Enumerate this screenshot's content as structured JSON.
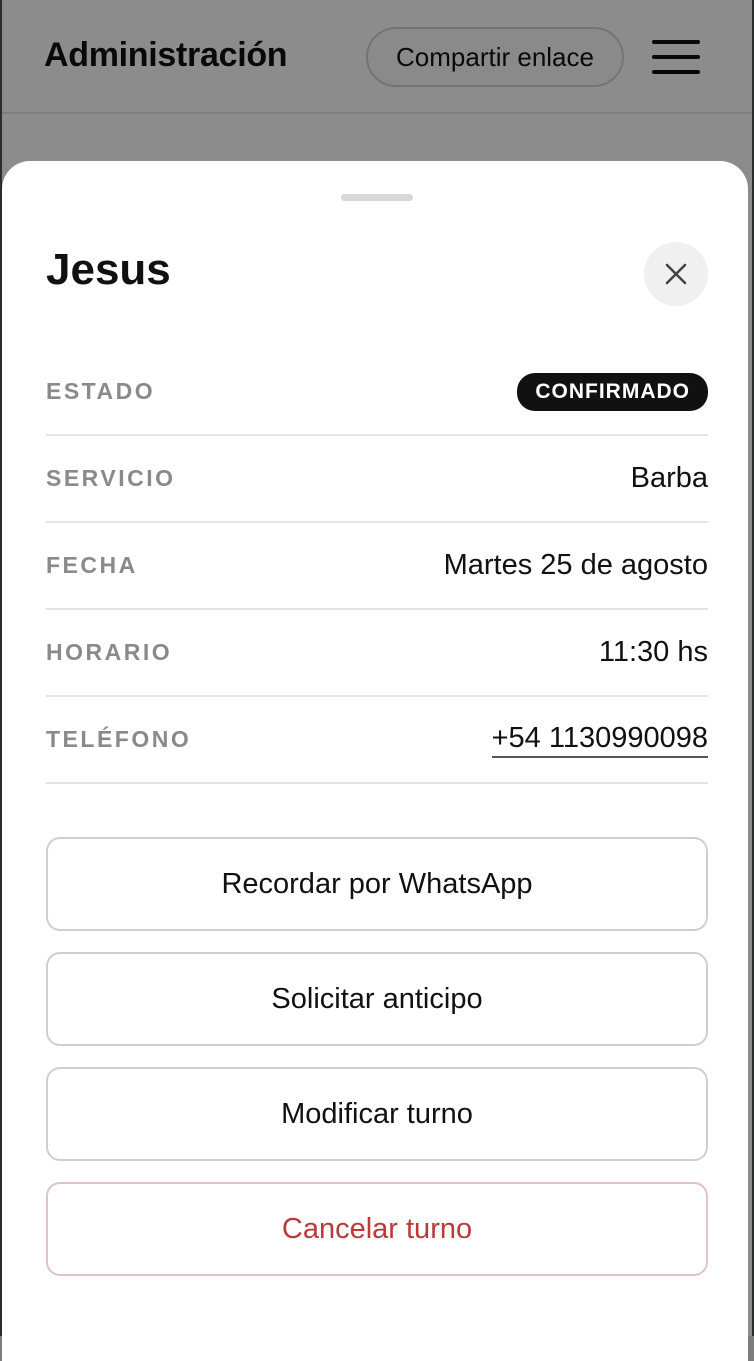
{
  "header": {
    "title": "Administración",
    "share_label": "Compartir enlace",
    "menu_icon": "hamburger-menu-icon"
  },
  "sheet": {
    "client_name": "Jesus",
    "close_icon": "close-icon",
    "details": {
      "status_label": "ESTADO",
      "status_value": "CONFIRMADO",
      "service_label": "SERVICIO",
      "service_value": "Barba",
      "date_label": "FECHA",
      "date_value": "Martes 25 de agosto",
      "time_label": "HORARIO",
      "time_value": "11:30 hs",
      "phone_label": "TELÉFONO",
      "phone_value": "+54 1130990098"
    },
    "actions": {
      "whatsapp_label": "Recordar por WhatsApp",
      "deposit_label": "Solicitar anticipo",
      "modify_label": "Modificar turno",
      "cancel_label": "Cancelar turno"
    }
  },
  "colors": {
    "badge_bg": "#111111",
    "danger": "#b83a3a",
    "label_gray": "#8a8a8a"
  }
}
